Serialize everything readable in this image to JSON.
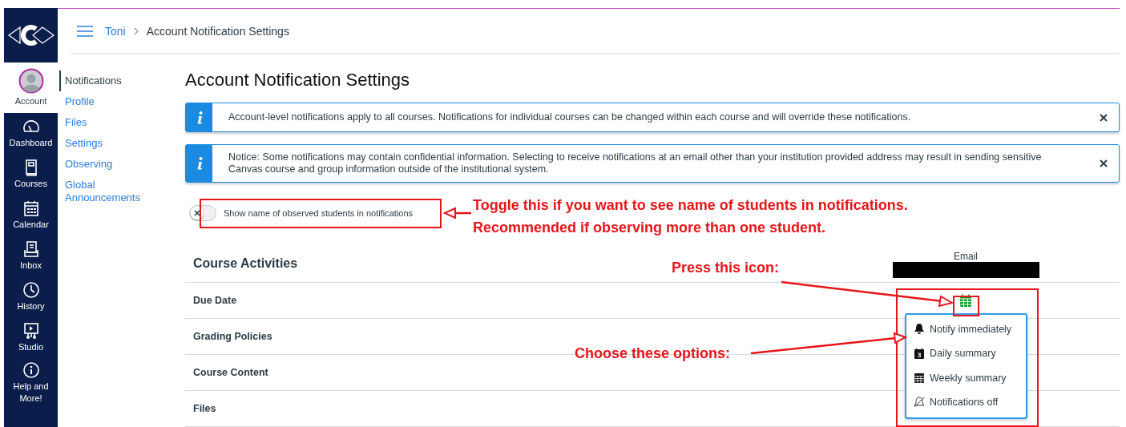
{
  "global_nav": [
    {
      "label": "Account",
      "selected": true
    },
    {
      "label": "Dashboard",
      "selected": false
    },
    {
      "label": "Courses",
      "selected": false
    },
    {
      "label": "Calendar",
      "selected": false
    },
    {
      "label": "Inbox",
      "selected": false
    },
    {
      "label": "History",
      "selected": false
    },
    {
      "label": "Studio",
      "selected": false
    },
    {
      "label": "Help and More!",
      "selected": false
    }
  ],
  "breadcrumb": [
    {
      "label": "Toni",
      "kind": "link"
    },
    {
      "label": "Account Notification Settings",
      "kind": "current"
    }
  ],
  "sidebar": {
    "items": [
      {
        "label": "Notifications",
        "selected": true
      },
      {
        "label": "Profile",
        "selected": false
      },
      {
        "label": "Files",
        "selected": false
      },
      {
        "label": "Settings",
        "selected": false
      },
      {
        "label": "Observing",
        "selected": false
      },
      {
        "label": "Global Announcements",
        "selected": false
      }
    ]
  },
  "page_title": "Account Notification Settings",
  "alerts": [
    {
      "text": "Account-level notifications apply to all courses. Notifications for individual courses can be changed within each course and will override these notifications."
    },
    {
      "text": "Notice: Some notifications may contain confidential information. Selecting to receive notifications at an email other than your institution provided address may result in sending sensitive Canvas course and group information outside of the institutional system."
    }
  ],
  "toggle": {
    "label": "Show name of observed students in notifications",
    "on": false
  },
  "table": {
    "section": "Course Activities",
    "column": "Email",
    "rows": [
      {
        "name": "Due Date",
        "kind": "weekly"
      },
      {
        "name": "Grading Policies",
        "kind": "empty"
      },
      {
        "name": "Course Content",
        "kind": "empty"
      },
      {
        "name": "Files",
        "kind": "empty"
      }
    ]
  },
  "menu": {
    "items": [
      {
        "label": "Notify immediately",
        "kind": "immediately"
      },
      {
        "label": "Daily summary",
        "kind": "daily"
      },
      {
        "label": "Weekly summary",
        "kind": "weekly"
      },
      {
        "label": "Notifications off",
        "kind": "off"
      }
    ]
  },
  "annotations": {
    "toggle_note": [
      "Toggle this if you want to see name of students in notifications.",
      "Recommended if observing more than one student."
    ],
    "icon_note": "Press this icon:",
    "options_note": "Choose these options:"
  }
}
